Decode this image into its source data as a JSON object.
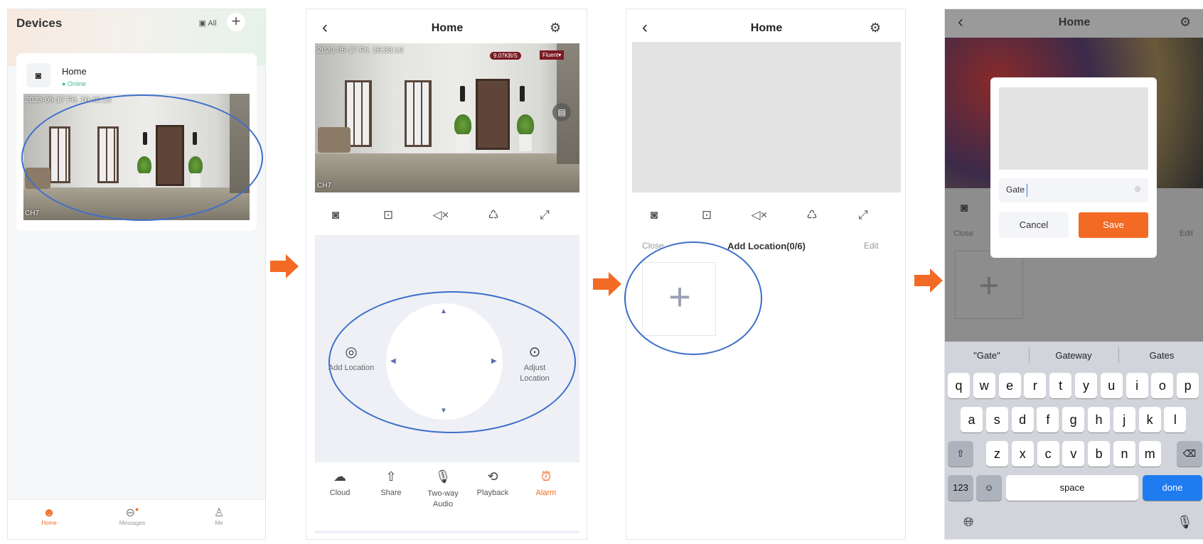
{
  "colors": {
    "accent": "#f26a24",
    "online": "#3bbf8a",
    "oval": "#3d6fc9",
    "done_blue": "#1f7cf0"
  },
  "screen1": {
    "title": "Devices",
    "all_label": "All",
    "device_name": "Home",
    "device_status": "Online",
    "timestamp": "2023-05-17  Fri.  10:45:13",
    "channel": "CH7",
    "nav": [
      {
        "label": "Home",
        "icon": "home-icon"
      },
      {
        "label": "Messages",
        "icon": "messages-icon"
      },
      {
        "label": "Me",
        "icon": "user-icon"
      }
    ]
  },
  "screen2": {
    "title": "Home",
    "timestamp": "2023-05-17  Fri.  15:33:13",
    "bitrate": "9.07KB/S",
    "quality": "Fluent",
    "channel": "CH7",
    "add_location": "Add Location",
    "adjust_location": "Adjust Location",
    "actions": [
      {
        "label": "Cloud",
        "icon": "cloud-icon"
      },
      {
        "label": "Share",
        "icon": "share-icon"
      },
      {
        "label": "Two-way Audio",
        "icon": "microphone-icon"
      },
      {
        "label": "Playback",
        "icon": "playback-icon"
      },
      {
        "label": "Alarm",
        "icon": "alarm-icon"
      }
    ]
  },
  "screen3": {
    "title": "Home",
    "close_label": "Close",
    "add_location_title": "Add Location(0/6)",
    "edit_label": "Edit"
  },
  "screen4": {
    "title": "Home",
    "close_label": "Close",
    "edit_label": "Edit",
    "input_value": "Gate",
    "cancel_label": "Cancel",
    "save_label": "Save",
    "suggestions": [
      "\"Gate\"",
      "Gateway",
      "Gates"
    ],
    "row1": [
      "q",
      "w",
      "e",
      "r",
      "t",
      "y",
      "u",
      "i",
      "o",
      "p"
    ],
    "row2": [
      "a",
      "s",
      "d",
      "f",
      "g",
      "h",
      "j",
      "k",
      "l"
    ],
    "row3": [
      "z",
      "x",
      "c",
      "v",
      "b",
      "n",
      "m"
    ],
    "numbers_key": "123",
    "space_key": "space",
    "done_key": "done"
  }
}
